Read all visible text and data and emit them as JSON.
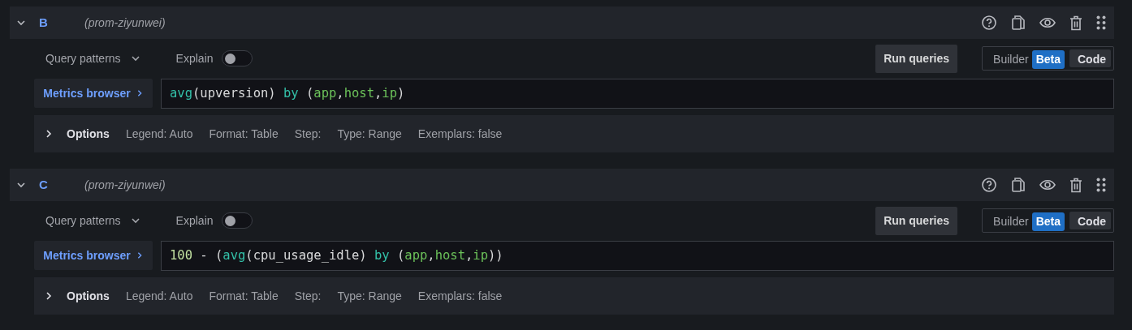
{
  "queries": [
    {
      "ref": "B",
      "expanded": true,
      "datasource": "(prom-ziyunwei)",
      "query_patterns": "Query patterns",
      "explain": {
        "label": "Explain",
        "on": false
      },
      "run_button": "Run queries",
      "editor_modes": [
        {
          "label": "Builder",
          "badge": "Beta",
          "selected": false
        },
        {
          "label": "Code",
          "selected": true
        }
      ],
      "metrics_browser": "Metrics browser",
      "query_tokens": [
        {
          "kind": "function",
          "text": "avg"
        },
        {
          "kind": "text",
          "text": "(upversion) "
        },
        {
          "kind": "keyword",
          "text": "by"
        },
        {
          "kind": "text",
          "text": " ("
        },
        {
          "kind": "label",
          "text": "app"
        },
        {
          "kind": "text",
          "text": ","
        },
        {
          "kind": "label",
          "text": "host"
        },
        {
          "kind": "text",
          "text": ","
        },
        {
          "kind": "label",
          "text": "ip"
        },
        {
          "kind": "text",
          "text": ")"
        }
      ],
      "options": {
        "label": "Options",
        "expanded": false,
        "items": [
          "Legend: Auto",
          "Format: Table",
          "Step:",
          "Type: Range",
          "Exemplars: false"
        ]
      }
    },
    {
      "ref": "C",
      "expanded": true,
      "datasource": "(prom-ziyunwei)",
      "query_patterns": "Query patterns",
      "explain": {
        "label": "Explain",
        "on": false
      },
      "run_button": "Run queries",
      "editor_modes": [
        {
          "label": "Builder",
          "badge": "Beta",
          "selected": false
        },
        {
          "label": "Code",
          "selected": true
        }
      ],
      "metrics_browser": "Metrics browser",
      "query_tokens": [
        {
          "kind": "number",
          "text": "100"
        },
        {
          "kind": "text",
          "text": " - ("
        },
        {
          "kind": "function",
          "text": "avg"
        },
        {
          "kind": "text",
          "text": "(cpu_usage_idle) "
        },
        {
          "kind": "keyword",
          "text": "by"
        },
        {
          "kind": "text",
          "text": " ("
        },
        {
          "kind": "label",
          "text": "app"
        },
        {
          "kind": "text",
          "text": ","
        },
        {
          "kind": "label",
          "text": "host"
        },
        {
          "kind": "text",
          "text": ","
        },
        {
          "kind": "label",
          "text": "ip"
        },
        {
          "kind": "text",
          "text": "))"
        }
      ],
      "options": {
        "label": "Options",
        "expanded": false,
        "items": [
          "Legend: Auto",
          "Format: Table",
          "Step:",
          "Type: Range",
          "Exemplars: false"
        ]
      }
    }
  ]
}
